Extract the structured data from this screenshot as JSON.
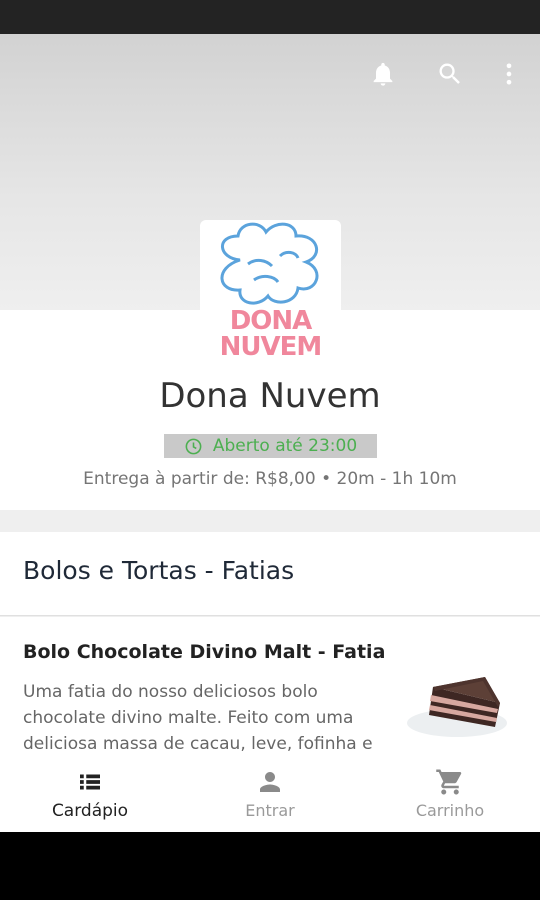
{
  "toolbar": {
    "notifications_icon": "bell-icon",
    "search_icon": "search-icon",
    "more_icon": "more-vertical-icon",
    "icon_color": "#ffffff"
  },
  "store": {
    "logo_line1": "DONA",
    "logo_line2": "NUVEM",
    "name": "Dona Nuvem",
    "status": "Aberto até 23:00",
    "status_color": "#4caf50",
    "delivery_info": "Entrega à partir de: R$8,00 • 20m - 1h 10m"
  },
  "menu": {
    "section_title": "Bolos e Tortas - Fatias",
    "products": [
      {
        "name": "Bolo Chocolate Divino Malt - Fatia",
        "description": "Uma fatia do nosso deliciosos bolo chocolate divino malte. Feito com uma deliciosa massa de cacau, leve, fofinha e"
      }
    ]
  },
  "bottom_nav": {
    "items": [
      {
        "label": "Cardápio",
        "icon": "menu-list-icon",
        "active": true
      },
      {
        "label": "Entrar",
        "icon": "person-icon",
        "active": false
      },
      {
        "label": "Carrinho",
        "icon": "cart-icon",
        "active": false
      }
    ]
  }
}
